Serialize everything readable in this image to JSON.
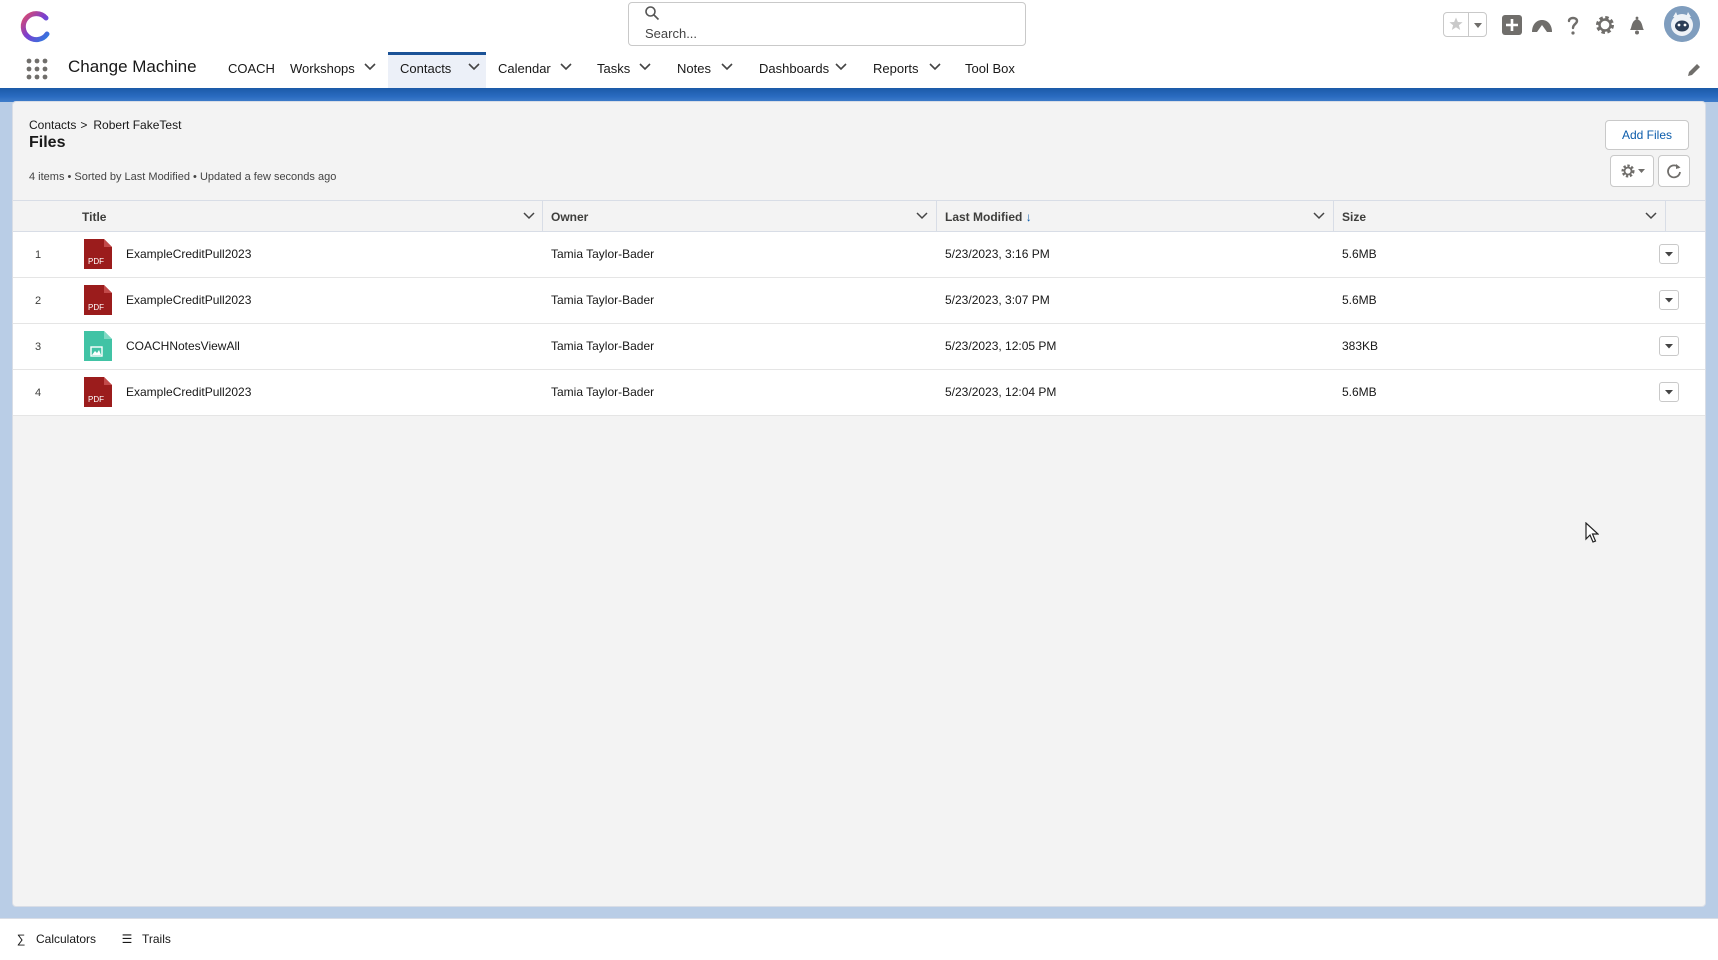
{
  "header": {
    "search_placeholder": "Search...",
    "icons": [
      "favorites-star-icon",
      "add-icon",
      "trailhead-icon",
      "help-icon",
      "setup-gear-icon",
      "notifications-bell-icon",
      "avatar"
    ]
  },
  "nav": {
    "app_name": "Change Machine",
    "items": [
      {
        "label": "COACH"
      },
      {
        "label": "Workshops"
      },
      {
        "label": "Contacts"
      },
      {
        "label": "Calendar"
      },
      {
        "label": "Tasks"
      },
      {
        "label": "Notes"
      },
      {
        "label": "Dashboards"
      },
      {
        "label": "Reports"
      },
      {
        "label": "Tool Box"
      }
    ],
    "active": "Contacts"
  },
  "page": {
    "breadcrumb": {
      "parent": "Contacts",
      "separator": ">",
      "current": "Robert FakeTest"
    },
    "title": "Files",
    "meta": "4 items • Sorted by Last Modified • Updated a few seconds ago",
    "add_files_label": "Add Files"
  },
  "table": {
    "columns": {
      "title": "Title",
      "owner": "Owner",
      "last_modified": "Last Modified",
      "size": "Size"
    },
    "sort_indicator": "↓",
    "rows": [
      {
        "num": "1",
        "type": "pdf",
        "icon_text": "PDF",
        "title": "ExampleCreditPull2023",
        "owner": "Tamia Taylor-Bader",
        "modified": "5/23/2023, 3:16 PM",
        "size": "5.6MB"
      },
      {
        "num": "2",
        "type": "pdf",
        "icon_text": "PDF",
        "title": "ExampleCreditPull2023",
        "owner": "Tamia Taylor-Bader",
        "modified": "5/23/2023, 3:07 PM",
        "size": "5.6MB"
      },
      {
        "num": "3",
        "type": "image",
        "icon_text": "",
        "title": "COACHNotesViewAll",
        "owner": "Tamia Taylor-Bader",
        "modified": "5/23/2023, 12:05 PM",
        "size": "383KB"
      },
      {
        "num": "4",
        "type": "pdf",
        "icon_text": "PDF",
        "title": "ExampleCreditPull2023",
        "owner": "Tamia Taylor-Bader",
        "modified": "5/23/2023, 12:04 PM",
        "size": "5.6MB"
      }
    ]
  },
  "footer": {
    "calculators_label": "Calculators",
    "trails_label": "Trails"
  },
  "colors": {
    "brand_blue": "#1b5297",
    "link_blue": "#0b5cab",
    "pdf_red": "#9b1c1c",
    "image_teal": "#41c3a5"
  }
}
